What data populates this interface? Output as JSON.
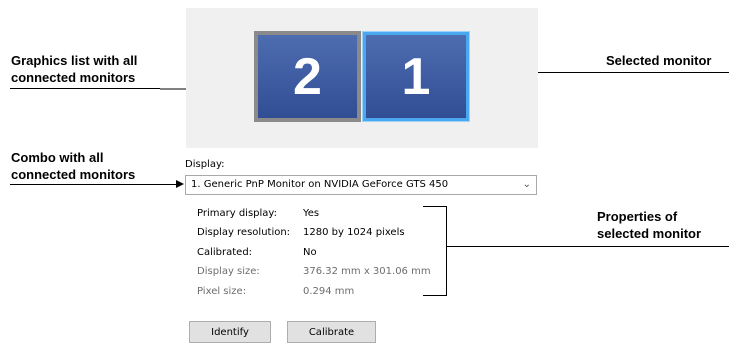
{
  "annotations": {
    "graphics_list": [
      "Graphics list with all",
      "connected monitors"
    ],
    "selected_monitor": "Selected monitor",
    "combo": [
      "Combo with all",
      "connected monitors"
    ],
    "properties": [
      "Properties of",
      "selected monitor"
    ]
  },
  "monitors": [
    {
      "number": "2",
      "selected": false
    },
    {
      "number": "1",
      "selected": true
    }
  ],
  "display_label": "Display:",
  "display_combo_value": "1. Generic PnP Monitor on NVIDIA GeForce GTS 450",
  "properties": [
    {
      "label": "Primary display:",
      "value": "Yes"
    },
    {
      "label": "Display resolution:",
      "value": "1280 by 1024 pixels"
    },
    {
      "label": "Calibrated:",
      "value": "No"
    },
    {
      "label": "Display size:",
      "value": "376.32 mm x 301.06 mm"
    },
    {
      "label": "Pixel size:",
      "value": "0.294 mm"
    }
  ],
  "buttons": {
    "identify": "Identify",
    "calibrate": "Calibrate"
  },
  "icons": {
    "combo_arrow": "chevron-down-icon"
  }
}
